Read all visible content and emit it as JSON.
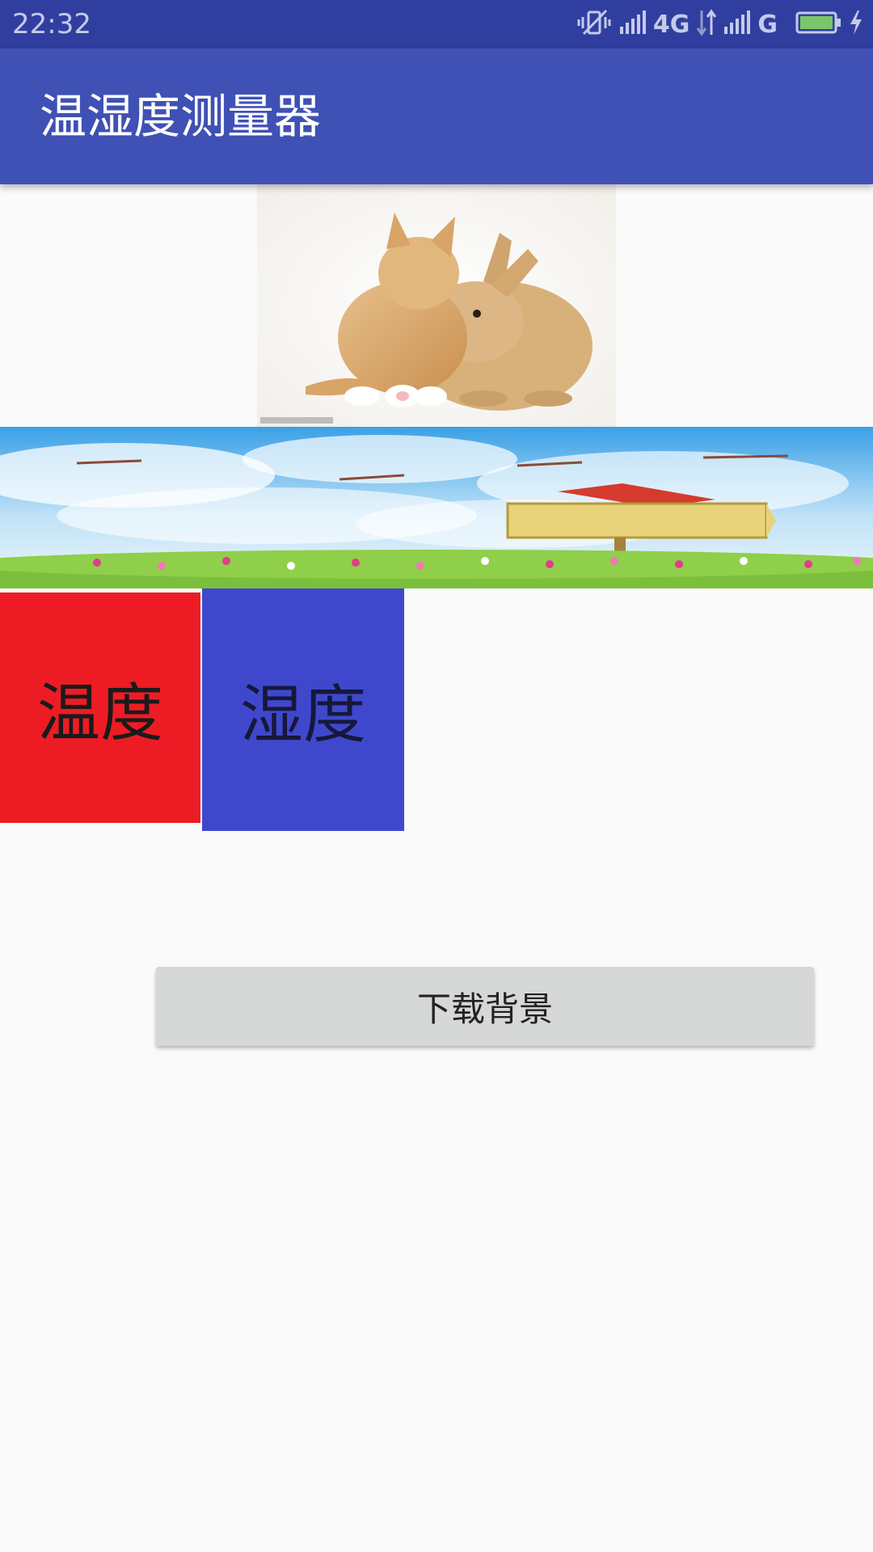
{
  "status_bar": {
    "time": "22:32",
    "network_primary": "4G",
    "network_secondary": "G",
    "icons": [
      "vibrate-off-icon",
      "signal-icon",
      "data-arrows-icon",
      "signal-icon",
      "battery-icon",
      "charging-icon"
    ]
  },
  "app_bar": {
    "title": "温湿度测量器"
  },
  "tiles": {
    "temperature_label": "温度",
    "humidity_label": "湿度",
    "temperature_color": "#ed1c24",
    "humidity_color": "#3f48cc"
  },
  "actions": {
    "download_background_label": "下载背景"
  },
  "colors": {
    "status_bar": "#303f9f",
    "app_bar": "#3f51b5",
    "background": "#fafafa",
    "button": "#d6d7d7"
  }
}
